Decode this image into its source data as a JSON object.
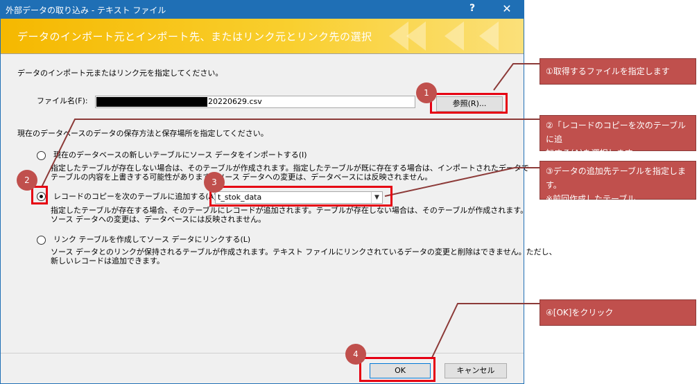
{
  "window": {
    "title": "外部データの取り込み - テキスト ファイル",
    "help_glyph": "?",
    "close_glyph": "✕"
  },
  "banner": {
    "heading": "データのインポート元とインポート先、またはリンク元とリンク先の選択"
  },
  "source": {
    "instruction": "データのインポート元またはリンク元を指定してください。",
    "file_label": "ファイル名(F):",
    "file_value": "20220629.csv",
    "browse_label": "参照(R)..."
  },
  "storage": {
    "instruction": "現在のデータベースのデータの保存方法と保存場所を指定してください。",
    "options": [
      {
        "label": "現在のデータベースの新しいテーブルにソース データをインポートする(I)",
        "desc1": "指定したテーブルが存在しない場合は、そのテーブルが作成されます。指定したテーブルが既に存在する場合は、インポートされたデータで",
        "desc2": "テーブルの内容を上書きする可能性があります。ソース データへの変更は、データベースには反映されません。",
        "selected": false
      },
      {
        "label": "レコードのコピーを次のテーブルに追加する(A):",
        "table_value": "t_stok_data",
        "desc1": "指定したテーブルが存在する場合、そのテーブルにレコードが追加されます。テーブルが存在しない場合は、そのテーブルが作成されます。",
        "desc2": "ソース データへの変更は、データベースには反映されません。",
        "selected": true
      },
      {
        "label": "リンク テーブルを作成してソース データにリンクする(L)",
        "desc1": "ソース データとのリンクが保持されるテーブルが作成されます。テキスト ファイルにリンクされているデータの変更と削除はできません。ただし、",
        "desc2": "新しいレコードは追加できます。",
        "selected": false
      }
    ]
  },
  "buttons": {
    "ok": "OK",
    "cancel": "キャンセル"
  },
  "annotations": {
    "badges": [
      "1",
      "2",
      "3",
      "4"
    ],
    "callout1": "①取得するファイルを指定します",
    "callout2_line1": "②「レコードのコピーを次のテーブルに追",
    "callout2_line2": "加する(A)を選択します",
    "callout3_line1": "③データの追加先テーブルを指定します。",
    "callout3_line2": "※前回作成したテーブル",
    "callout4": "④[OK]をクリック",
    "color": "#c0504d",
    "highlight_color": "#e60012"
  }
}
